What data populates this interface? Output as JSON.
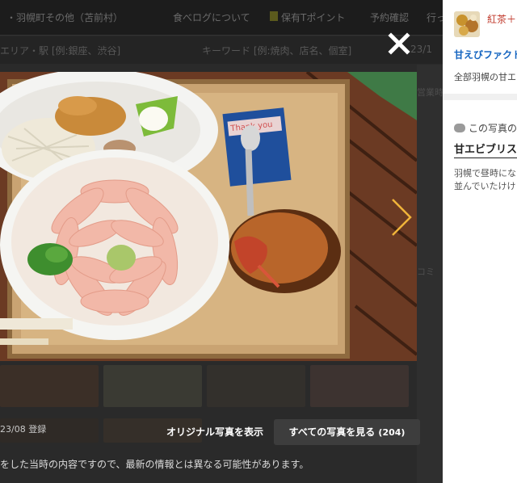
{
  "background_page": {
    "area_text": "・羽幌町その他（苫前村）",
    "nav_items": [
      "食べログについて",
      "保有Tポイント",
      "予約確認",
      "行っ"
    ],
    "search_area": "エリア・駅 [例:銀座、渋谷]",
    "search_keyword": "キーワード [例:焼肉、店名、個室]",
    "search_date": "23/1",
    "side_labels": [
      "営業時",
      "コミ"
    ]
  },
  "photo": {
    "alt": "甘えびブリスケット丼と味噌汁",
    "card_text": "Thank you"
  },
  "controls": {
    "close_label": "×",
    "next_label": "›"
  },
  "photo_info": {
    "date": "23/08 登録",
    "original_button": "オリジナル写真を表示",
    "all_photos_button": "すべての写真を見る",
    "all_photos_count": "(204)",
    "notice": "をした当時の内容ですので、最新の情報とは異なる可能性があります。"
  },
  "side_panel": {
    "user_name": "紅茶＋",
    "shop_name": "甘えびファクト",
    "shop_area": "全部羽幌の甘エ",
    "comment_heading": "この写真の",
    "review_title": "甘エビブリス",
    "review_lines": [
      "羽幌で昼時にな",
      "並んでいたけけ"
    ]
  },
  "colors": {
    "accent_blue": "#1565c0",
    "user_red": "#c0392b",
    "overlay": "#1b1b1b"
  }
}
